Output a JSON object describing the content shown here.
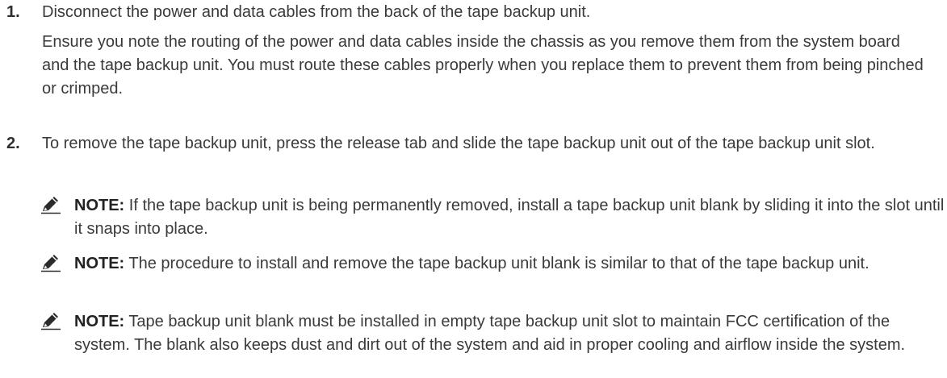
{
  "steps": [
    {
      "number": "1.",
      "text": "Disconnect the power and data cables from the back of the tape backup unit.",
      "detail": "Ensure you note the routing of the power and data cables inside the chassis as you remove them from the system board and the tape backup unit. You must route these cables properly when you replace them to prevent them from being pinched or crimped."
    },
    {
      "number": "2.",
      "text": "To remove the tape backup unit, press the release tab and slide the tape backup unit out of the tape backup unit slot."
    }
  ],
  "notes": [
    {
      "icon": "note-pencil-icon",
      "label": "NOTE:",
      "text": " If the tape backup unit is being permanently removed, install a tape backup unit blank by sliding it into the slot until it snaps into place."
    },
    {
      "icon": "note-pencil-icon",
      "label": "NOTE:",
      "text": " The procedure to install and remove the tape backup unit blank is similar to that of the tape backup unit."
    },
    {
      "icon": "note-pencil-icon",
      "label": "NOTE:",
      "text": " Tape backup unit blank must be installed in empty tape backup unit slot to maintain FCC certification of the system. The blank also keeps dust and dirt out of the system and aid in proper cooling and airflow inside the system."
    }
  ]
}
